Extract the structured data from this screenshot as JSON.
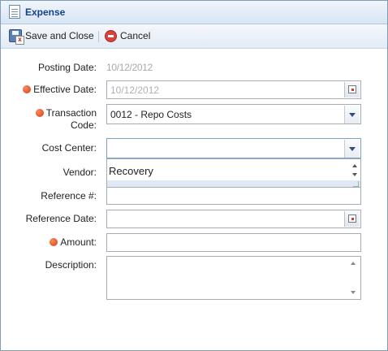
{
  "window": {
    "title": "Expense"
  },
  "toolbar": {
    "save_close_label": "Save and Close",
    "cancel_label": "Cancel"
  },
  "form": {
    "posting_date": {
      "label": "Posting Date:",
      "value": "10/12/2012"
    },
    "effective_date": {
      "label": "Effective Date:",
      "value": "10/12/2012",
      "required": true
    },
    "transaction_code": {
      "label_line1": "Transaction",
      "label_line2": "Code:",
      "value": "0012 - Repo Costs",
      "required": true
    },
    "cost_center": {
      "label": "Cost Center:",
      "value": ""
    },
    "vendor": {
      "label": "Vendor:",
      "dropdown_option": "Recovery"
    },
    "reference_no": {
      "label": "Reference #:",
      "value": ""
    },
    "reference_date": {
      "label": "Reference Date:",
      "value": ""
    },
    "amount": {
      "label": "Amount:",
      "value": "",
      "required": true
    },
    "description": {
      "label": "Description:",
      "value": ""
    }
  },
  "colors": {
    "title": "#15428b",
    "required_dot": "#d23c14",
    "border": "#7f9db9"
  }
}
